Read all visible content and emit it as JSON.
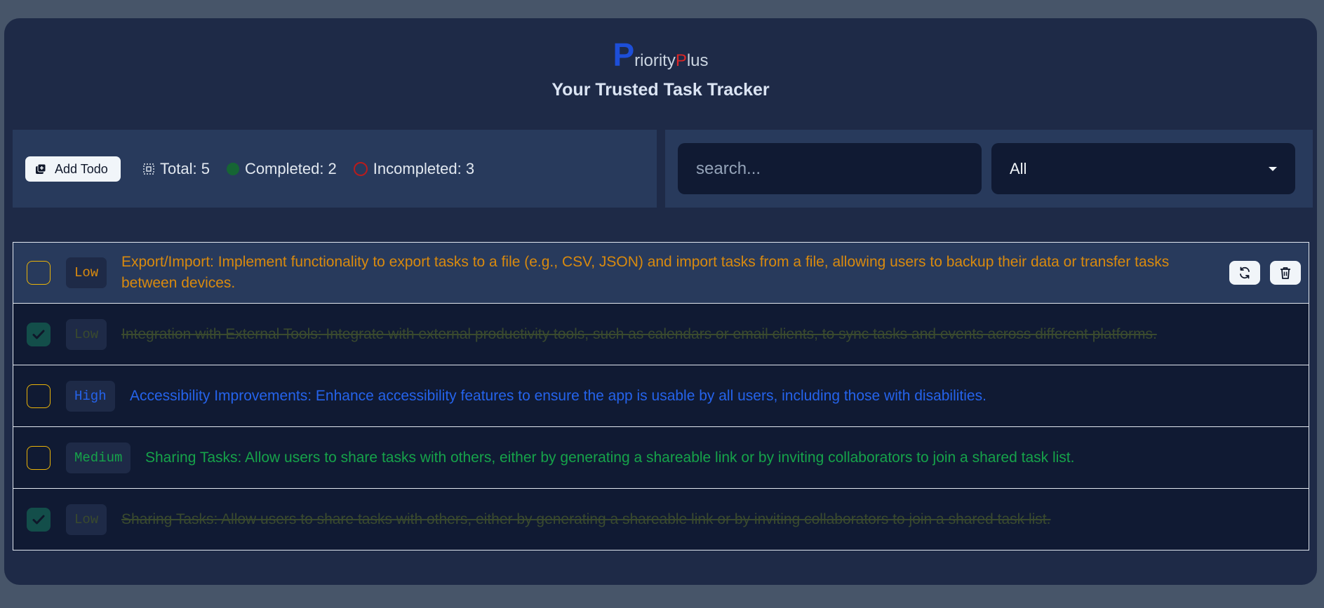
{
  "brand": {
    "initial_p": "P",
    "rest_1": "riority",
    "initial_p2": "P",
    "rest_2": "lus"
  },
  "subtitle": "Your Trusted Task Tracker",
  "toolbar": {
    "add_label": "Add Todo",
    "total_label": "Total: 5",
    "completed_label": "Completed: 2",
    "incompleted_label": "Incompleted: 3"
  },
  "search": {
    "placeholder": "search...",
    "value": ""
  },
  "filter": {
    "selected": "All"
  },
  "colors": {
    "low": "#d98a0e",
    "high": "#2563eb",
    "medium": "#16a34a",
    "done": "#3a4a2e"
  },
  "todos": [
    {
      "priority": "Low",
      "text": "Export/Import: Implement functionality to export tasks to a file (e.g., CSV, JSON) and import tasks from a file, allowing users to backup their data or transfer tasks between devices.",
      "completed": false
    },
    {
      "priority": "Low",
      "text": "Integration with External Tools: Integrate with external productivity tools, such as calendars or email clients, to sync tasks and events across different platforms.",
      "completed": true
    },
    {
      "priority": "High",
      "text": "Accessibility Improvements: Enhance accessibility features to ensure the app is usable by all users, including those with disabilities.",
      "completed": false
    },
    {
      "priority": "Medium",
      "text": "Sharing Tasks: Allow users to share tasks with others, either by generating a shareable link or by inviting collaborators to join a shared task list.",
      "completed": false
    },
    {
      "priority": "Low",
      "text": "Sharing Tasks: Allow users to share tasks with others, either by generating a shareable link or by inviting collaborators to join a shared task list.",
      "completed": true
    }
  ]
}
